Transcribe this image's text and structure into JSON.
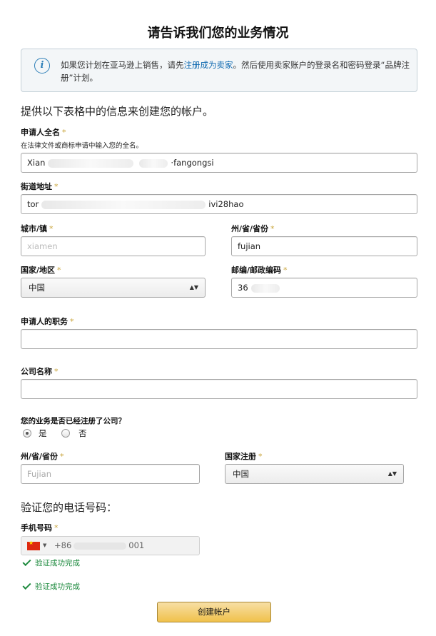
{
  "page": {
    "title": "请告诉我们您的业务情况"
  },
  "info_box": {
    "icon": "info-icon",
    "text_before": "如果您计划在亚马逊上销售，请先",
    "link": "注册成为卖家",
    "text_after": "。然后使用卖家账户的登录名和密码登录“品牌注册”计划。"
  },
  "intro": "提供以下表格中的信息来创建您的帐户。",
  "required_mark": "*",
  "form": {
    "full_name": {
      "label": "申请人全名",
      "hint": "在法律文件或商标申请中输入您的全名。",
      "value_start": "Xian",
      "value_end": "·fangongsi"
    },
    "street": {
      "label": "街道地址",
      "value_start": "tor",
      "value_end": "ivi28hao"
    },
    "city": {
      "label": "城市/镇",
      "value": "xiamen"
    },
    "state": {
      "label": "州/省/省份",
      "value": "fujian"
    },
    "country": {
      "label": "国家/地区",
      "value": "中国"
    },
    "postal": {
      "label": "邮编/邮政编码",
      "value": "36"
    },
    "job_title": {
      "label": "申请人的职务",
      "value": ""
    },
    "company": {
      "label": "公司名称",
      "value": ""
    },
    "registered_q": {
      "label": "您的业务是否已经注册了公司？",
      "yes": "是",
      "no": "否",
      "selected": "yes"
    },
    "reg_state": {
      "label": "州/省/省份",
      "value": "Fujian"
    },
    "reg_country": {
      "label": "国家注册",
      "value": "中国"
    }
  },
  "phone_section": {
    "heading": "验证您的电话号码：",
    "label": "手机号码",
    "flag": "china-flag-icon",
    "number_start": "+86",
    "number_end": "001",
    "verified_1": "验证成功完成",
    "verified_2": "验证成功完成"
  },
  "submit_label": "创建帐户",
  "colors": {
    "link": "#0e69b0",
    "required": "#c9a43a",
    "success": "#1d8a3e",
    "button": "#f0c14b"
  }
}
